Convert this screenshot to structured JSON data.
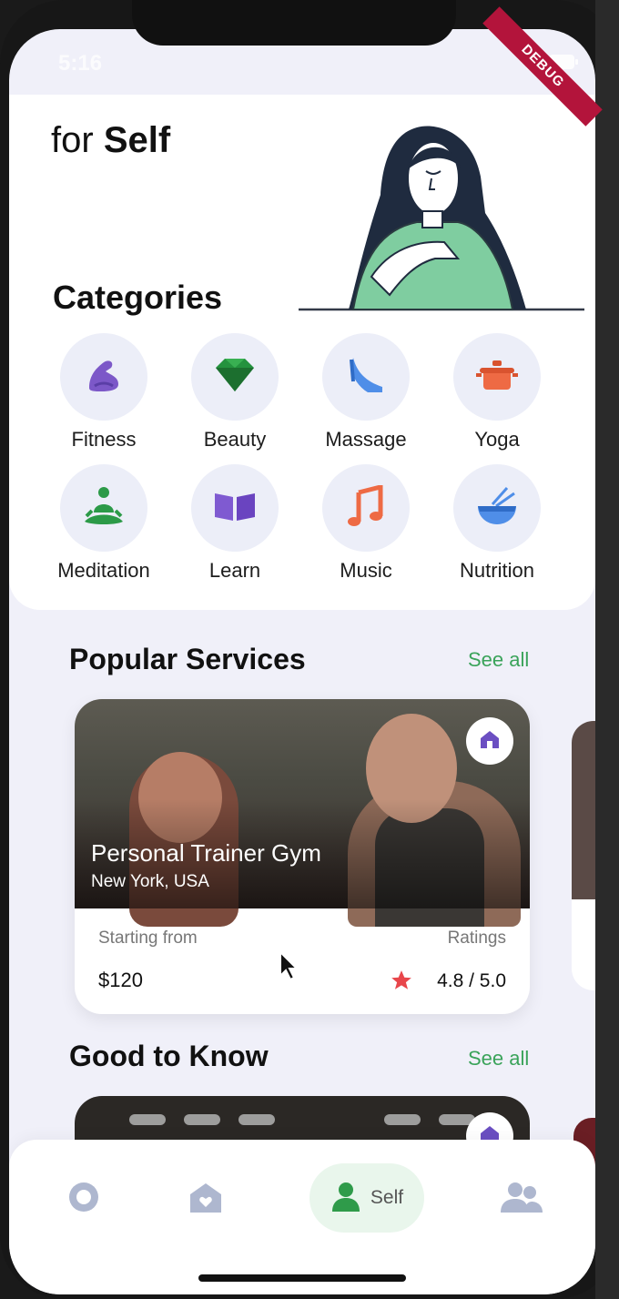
{
  "status_bar": {
    "time": "5:16",
    "debug_label": "DEBUG"
  },
  "hero": {
    "title_prefix": "for",
    "title_bold": "Self"
  },
  "categories": {
    "title": "Categories",
    "items": [
      {
        "label": "Fitness",
        "icon": "flexed-arm-icon"
      },
      {
        "label": "Beauty",
        "icon": "gem-icon"
      },
      {
        "label": "Massage",
        "icon": "high-heel-icon"
      },
      {
        "label": "Yoga",
        "icon": "pot-icon"
      },
      {
        "label": "Meditation",
        "icon": "meditating-person-icon"
      },
      {
        "label": "Learn",
        "icon": "open-book-icon"
      },
      {
        "label": "Music",
        "icon": "music-note-icon"
      },
      {
        "label": "Nutrition",
        "icon": "bowl-chopsticks-icon"
      }
    ]
  },
  "popular_services": {
    "title": "Popular Services",
    "see_all": "See all",
    "card": {
      "name": "Personal Trainer Gym",
      "location": "New York, USA",
      "price_label": "Starting from",
      "price": "$120",
      "rating_label": "Ratings",
      "rating": "4.8 / 5.0"
    }
  },
  "good_to_know": {
    "title": "Good to Know",
    "see_all": "See all"
  },
  "bottom_nav": {
    "items": [
      {
        "name": "circle-icon"
      },
      {
        "name": "home-heart-icon"
      },
      {
        "name": "person-icon",
        "label": "Self",
        "active": true
      },
      {
        "name": "people-icon"
      }
    ]
  },
  "colors": {
    "accent_green": "#3aa35a",
    "background": "#f0f0f9",
    "debug": "#b3143b"
  }
}
